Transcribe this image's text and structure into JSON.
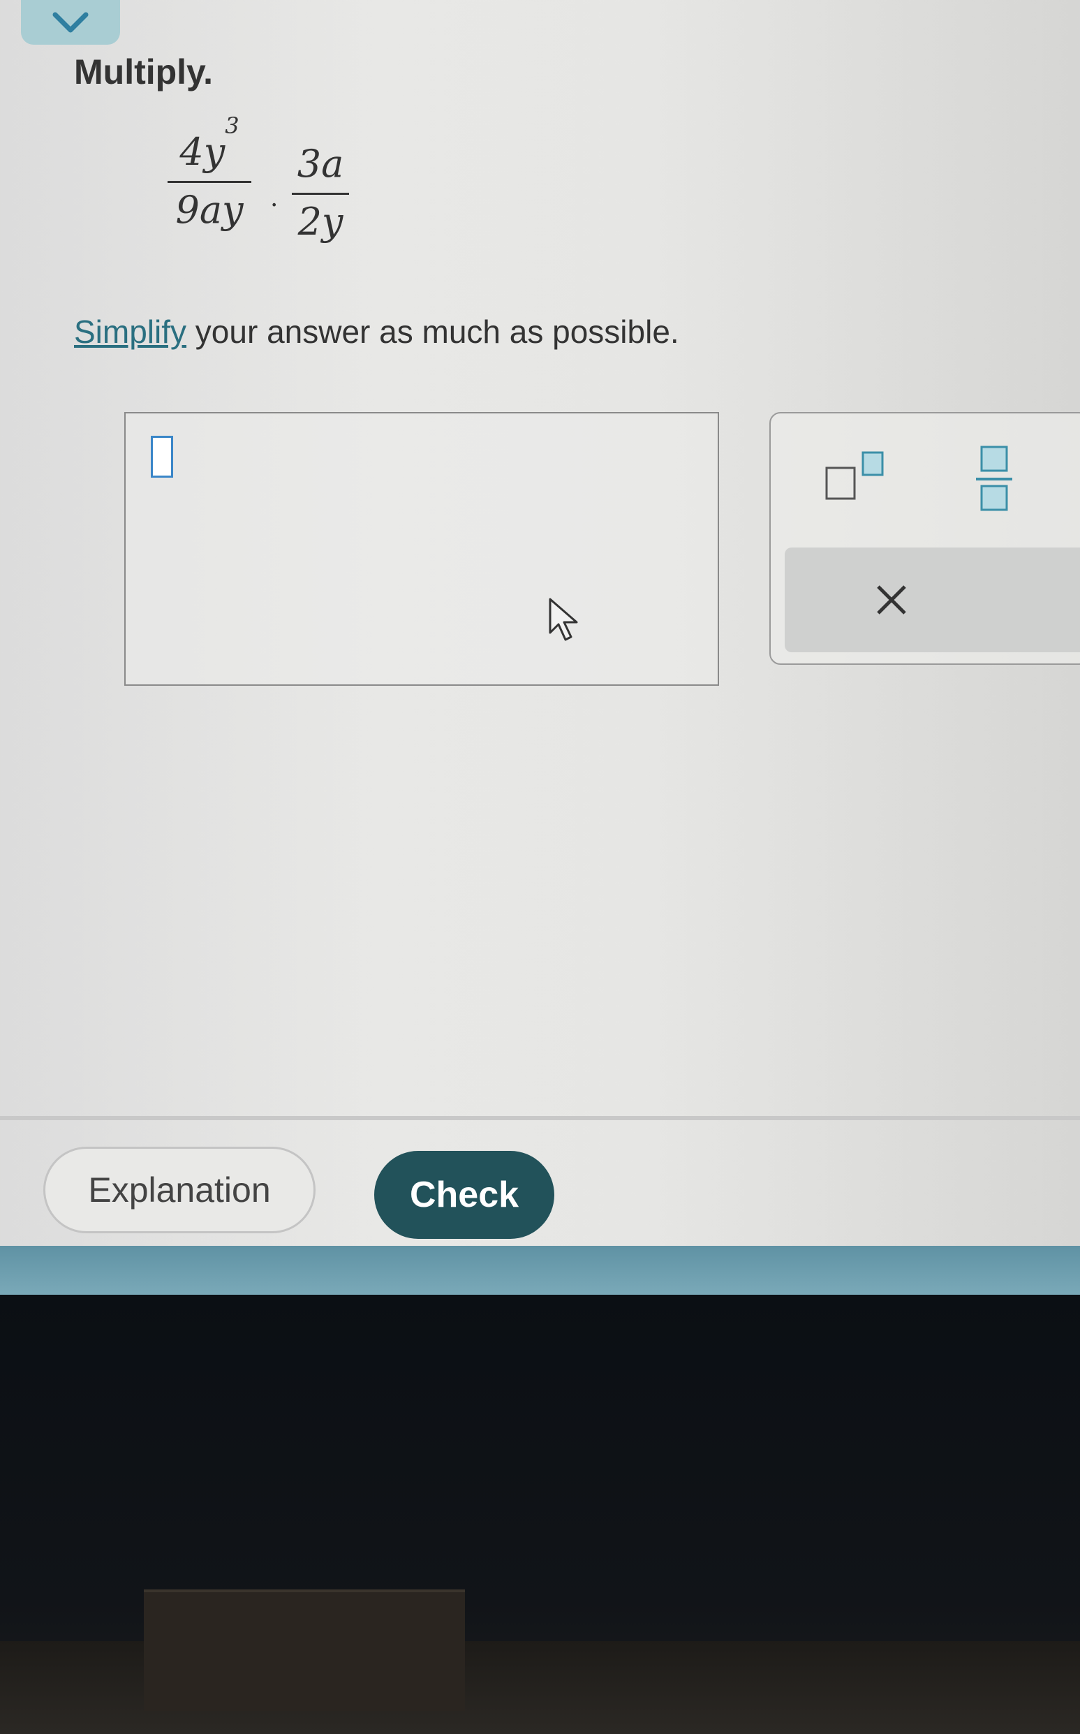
{
  "header": {
    "collapse_icon": "chevron-down-icon",
    "title": "Multiply."
  },
  "problem": {
    "fraction1": {
      "numerator_base": "4y",
      "numerator_exp": "3",
      "denominator": "9ay"
    },
    "operator": "·",
    "fraction2": {
      "numerator": "3a",
      "denominator": "2y"
    }
  },
  "instruction": {
    "link_text": "Simplify",
    "rest": " your answer as much as possible."
  },
  "answer": {
    "value": ""
  },
  "keypad": {
    "keys": [
      {
        "name": "exponent",
        "icon": "exponent-icon"
      },
      {
        "name": "fraction",
        "icon": "fraction-icon"
      },
      {
        "name": "clear",
        "label": "×",
        "icon": "close-icon"
      }
    ]
  },
  "footer": {
    "explanation_label": "Explanation",
    "check_label": "Check"
  },
  "colors": {
    "accent_teal": "#22525a",
    "link": "#2a6f80",
    "cursor_blue": "#3a86c8"
  }
}
